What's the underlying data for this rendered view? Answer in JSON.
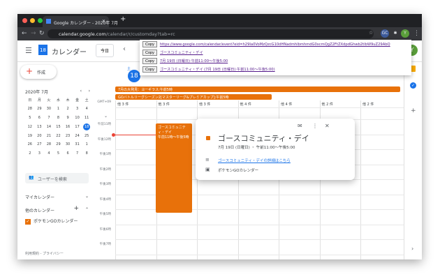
{
  "browser": {
    "tab_title": "Google カレンダー - 2020年 7月",
    "url_host": "calendar.google.com",
    "url_path": "/calendar/r/customday?tab=rc",
    "profile_initial": "Y",
    "ext_label": "GC"
  },
  "header": {
    "app_name": "カレンダー",
    "logo_day": "18",
    "today_button": "今日",
    "avatar": "Y"
  },
  "copy_menu": {
    "button": "Copy",
    "rows": [
      "https://www.google.com/calendar/event?eid=h29Ia0VoMzQzcG10dHNadmhlbmhmdG0xcmQgZ2FtZXdpdGhwb2tlbW9uZ29AbQ",
      "ゴースコミュニティ・デイ",
      "7月 19日 (日曜日)⋅午前11:00～午後5:00",
      "ゴースコミュニティ・デイ (7月 19日 (日曜日)⋅午前11:00～午後5:00)"
    ]
  },
  "sidebar": {
    "create": "作成",
    "month": "2020年 7月",
    "weekdays": [
      "日",
      "月",
      "火",
      "水",
      "木",
      "金",
      "土"
    ],
    "weeks": [
      [
        "28",
        "29",
        "30",
        "1",
        "2",
        "3",
        "4"
      ],
      [
        "5",
        "6",
        "7",
        "8",
        "9",
        "10",
        "11"
      ],
      [
        "12",
        "13",
        "14",
        "15",
        "16",
        "17",
        "18"
      ],
      [
        "19",
        "20",
        "21",
        "22",
        "23",
        "24",
        "25"
      ],
      [
        "26",
        "27",
        "28",
        "29",
        "30",
        "31",
        "1"
      ],
      [
        "2",
        "3",
        "4",
        "5",
        "6",
        "7",
        "8"
      ]
    ],
    "today": "18",
    "search_people": "ユーザーを検索",
    "my_calendars": "マイカレンダー",
    "other_calendars": "他のカレンダー",
    "calendar_item": "ポケモンGOカレンダー",
    "footer": "利用規約 - プライバシー"
  },
  "grid": {
    "day_header": "土",
    "day_number": "18",
    "timezone": "GMT+09",
    "allday": [
      "7月の大発見：ヨーギラス:午前5時",
      "GOバトルリーグシーズン2[マスターリーグ&プレミアカップ]:午前5時"
    ],
    "counts": [
      "他 3 件",
      "他 3 件",
      "他 3 件",
      "他 4 件",
      "他 4 件",
      "他 2 件",
      "他 2 件"
    ],
    "times": [
      "午前11時",
      "午後12時",
      "午後1時",
      "午後2時",
      "午後3時",
      "午後4時",
      "午後5時",
      "午後6時",
      "午後7時"
    ],
    "event": {
      "title": "ゴースコミュニティ・デイ",
      "time": "午前11時～午後5時"
    }
  },
  "popup": {
    "title": "ゴースコミュニティ・デイ",
    "datetime": "7月 19日 (日曜日) ・ 午前11:00～午後5:00",
    "link": "ゴースコミュニティ・デイの詳細はこちら",
    "calendar": "ポケモンGOカレンダー"
  },
  "colors": {
    "event": "#e8710a",
    "accent": "#1a73e8"
  }
}
